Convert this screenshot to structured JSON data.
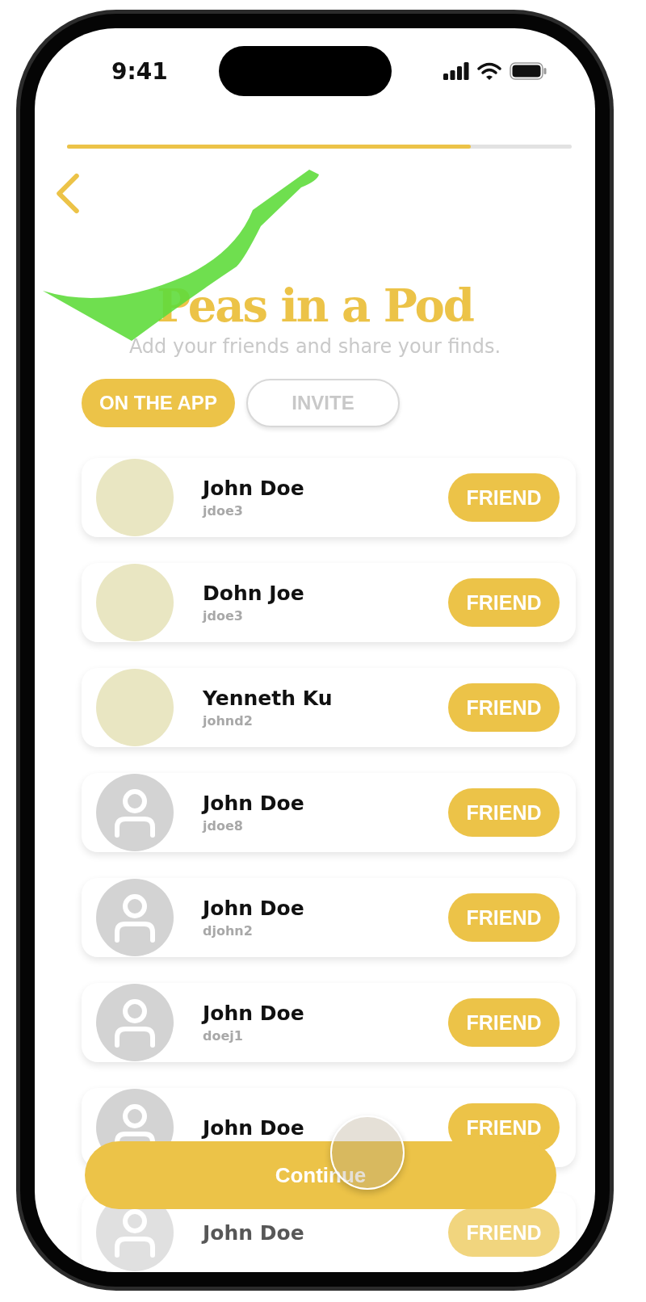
{
  "status_bar": {
    "time": "9:41"
  },
  "progress": {
    "level": 0.8
  },
  "title": "Peas in a Pod",
  "subtitle": "Add your friends and share your finds.",
  "tabs": [
    {
      "label": "ON THE APP",
      "selected": true
    },
    {
      "label": "INVITE",
      "selected": false
    }
  ],
  "friends": [
    {
      "name": "John Doe",
      "username": "jdoe3",
      "kind": "photo",
      "action": "FRIEND"
    },
    {
      "name": "Dohn Joe",
      "username": "jdoe3",
      "kind": "photo",
      "action": "FRIEND"
    },
    {
      "name": "Yenneth Ku",
      "username": "johnd2",
      "kind": "photo",
      "action": "FRIEND"
    },
    {
      "name": "John Doe",
      "username": "jdoe8",
      "kind": "default",
      "action": "FRIEND"
    },
    {
      "name": "John Doe",
      "username": "djohn2",
      "kind": "default",
      "action": "FRIEND"
    },
    {
      "name": "John Doe",
      "username": "doej1",
      "kind": "default",
      "action": "FRIEND"
    },
    {
      "name": "John Doe",
      "kind": "default",
      "action": "FRIEND"
    },
    {
      "name": "John Doe",
      "kind": "default",
      "action": "FRIEND"
    }
  ],
  "continue_button": "Continue"
}
